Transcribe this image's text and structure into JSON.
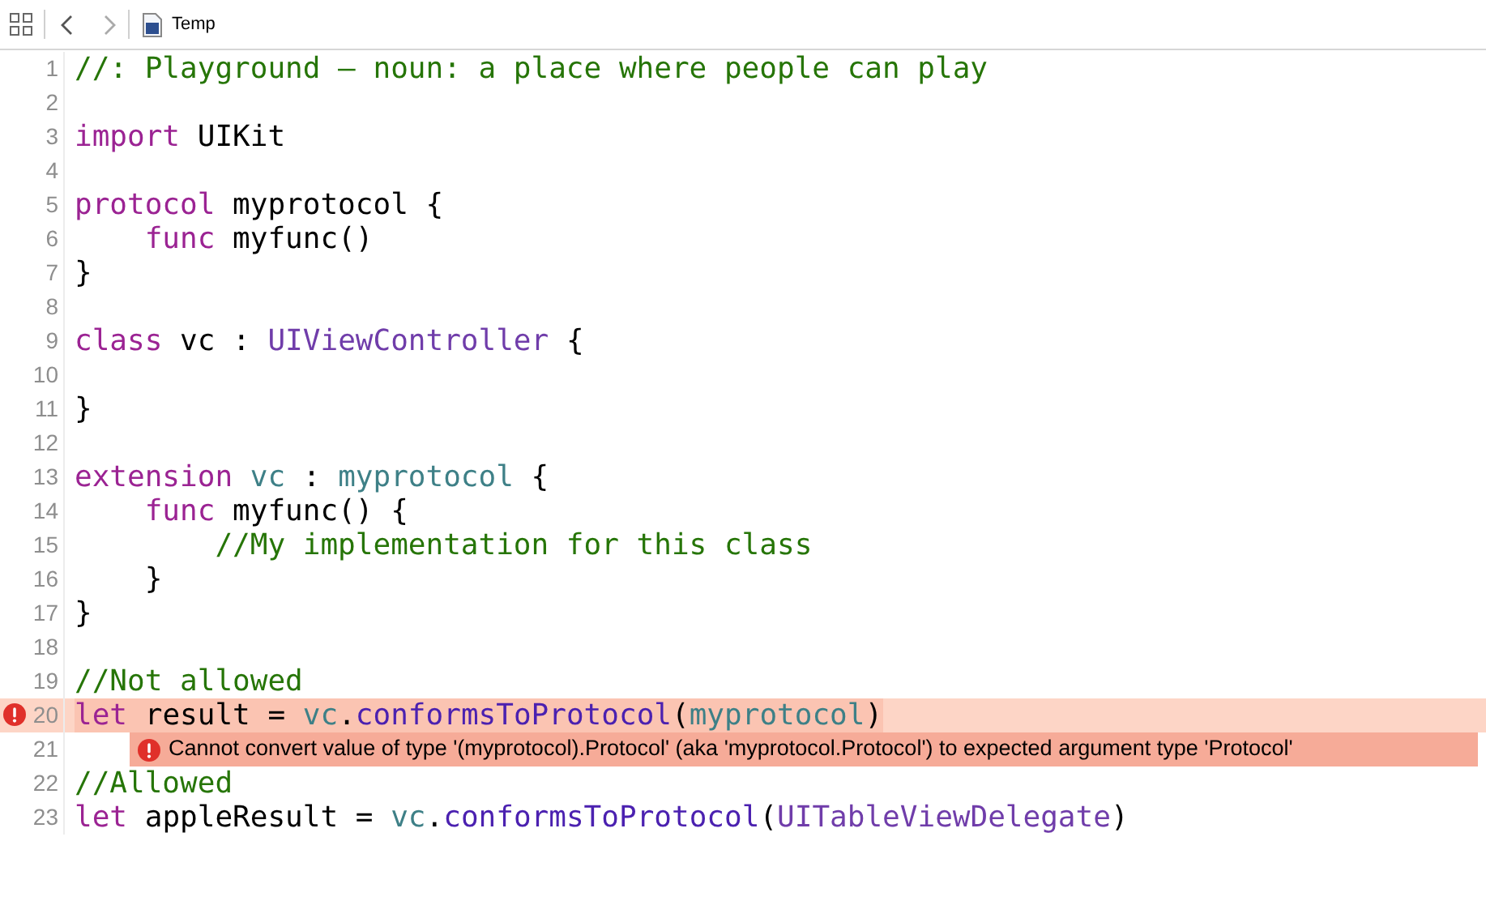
{
  "toolbar": {
    "file_name": "Temp"
  },
  "lines": [
    {
      "number": "1",
      "tokens": [
        {
          "kind": "comment",
          "text": "//: Playground — noun: a place where people can play"
        }
      ]
    },
    {
      "number": "2"
    },
    {
      "number": "3",
      "tokens": [
        {
          "kind": "keyword",
          "text": "import"
        },
        {
          "kind": "plain",
          "text": " UIKit"
        }
      ]
    },
    {
      "number": "4"
    },
    {
      "number": "5",
      "tokens": [
        {
          "kind": "keyword",
          "text": "protocol"
        },
        {
          "kind": "plain",
          "text": " myprotocol {"
        }
      ]
    },
    {
      "number": "6",
      "tokens": [
        {
          "kind": "keyword",
          "text": "    func"
        },
        {
          "kind": "plain",
          "text": " myfunc()"
        }
      ]
    },
    {
      "number": "7",
      "tokens": [
        {
          "kind": "plain",
          "text": "}"
        }
      ]
    },
    {
      "number": "8"
    },
    {
      "number": "9",
      "tokens": [
        {
          "kind": "keyword",
          "text": "class"
        },
        {
          "kind": "plain",
          "text": " vc : "
        },
        {
          "kind": "type",
          "text": "UIViewController"
        },
        {
          "kind": "plain",
          "text": " {"
        }
      ]
    },
    {
      "number": "10"
    },
    {
      "number": "11",
      "tokens": [
        {
          "kind": "plain",
          "text": "}"
        }
      ]
    },
    {
      "number": "12"
    },
    {
      "number": "13",
      "tokens": [
        {
          "kind": "keyword",
          "text": "extension"
        },
        {
          "kind": "project",
          "text": " vc"
        },
        {
          "kind": "plain",
          "text": " : "
        },
        {
          "kind": "project",
          "text": "myprotocol"
        },
        {
          "kind": "plain",
          "text": " {"
        }
      ]
    },
    {
      "number": "14",
      "tokens": [
        {
          "kind": "keyword",
          "text": "    func"
        },
        {
          "kind": "plain",
          "text": " myfunc() {"
        }
      ]
    },
    {
      "number": "15",
      "tokens": [
        {
          "kind": "comment",
          "text": "        //My implementation for this class"
        }
      ]
    },
    {
      "number": "16",
      "tokens": [
        {
          "kind": "plain",
          "text": "    }"
        }
      ]
    },
    {
      "number": "17",
      "tokens": [
        {
          "kind": "plain",
          "text": "}"
        }
      ]
    },
    {
      "number": "18"
    },
    {
      "number": "19",
      "tokens": [
        {
          "kind": "comment",
          "text": "//Not allowed"
        }
      ]
    },
    {
      "number": "20",
      "error": true,
      "tokens": [
        {
          "kind": "keyword",
          "text": "let"
        },
        {
          "kind": "plain",
          "text": " result = "
        },
        {
          "kind": "project",
          "text": "vc"
        },
        {
          "kind": "plain",
          "text": "."
        },
        {
          "kind": "method",
          "text": "conformsToProtocol"
        },
        {
          "kind": "plain",
          "text": "("
        },
        {
          "kind": "project",
          "text": "myprotocol"
        },
        {
          "kind": "plain",
          "text": ")"
        }
      ]
    },
    {
      "number": "21",
      "message": "Cannot convert value of type '(myprotocol).Protocol' (aka 'myprotocol.Protocol') to expected argument type 'Protocol'"
    },
    {
      "number": "22",
      "tokens": [
        {
          "kind": "comment",
          "text": "//Allowed"
        }
      ]
    },
    {
      "number": "23",
      "tokens": [
        {
          "kind": "keyword",
          "text": "let"
        },
        {
          "kind": "plain",
          "text": " appleResult = "
        },
        {
          "kind": "project",
          "text": "vc"
        },
        {
          "kind": "plain",
          "text": "."
        },
        {
          "kind": "method",
          "text": "conformsToProtocol"
        },
        {
          "kind": "plain",
          "text": "("
        },
        {
          "kind": "type",
          "text": "UITableViewDelegate"
        },
        {
          "kind": "plain",
          "text": ")"
        }
      ]
    }
  ]
}
